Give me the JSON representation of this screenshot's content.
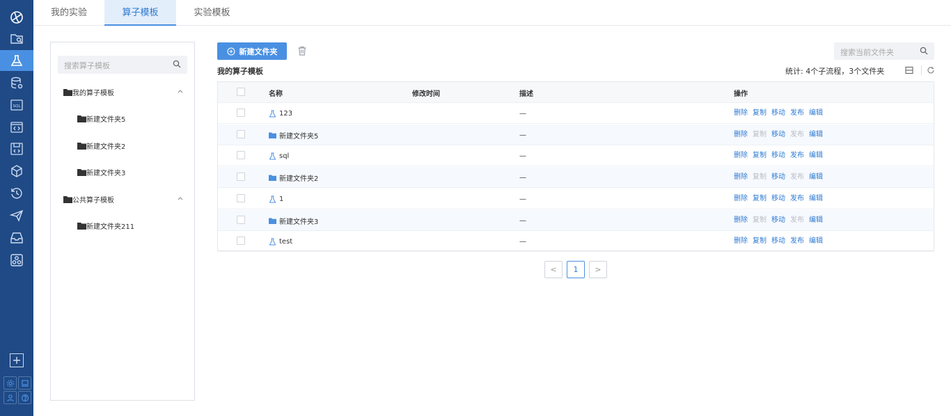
{
  "rail": {
    "items": [
      {
        "icon": "globe-icon"
      },
      {
        "icon": "folder-search-icon"
      },
      {
        "icon": "flask-icon",
        "active": true
      },
      {
        "icon": "database-icon"
      },
      {
        "icon": "sql-icon",
        "text": "SQL"
      },
      {
        "icon": "code-window-icon"
      },
      {
        "icon": "code-save-icon"
      },
      {
        "icon": "cube-icon"
      },
      {
        "icon": "history-icon"
      },
      {
        "icon": "send-icon"
      },
      {
        "icon": "inbox-icon"
      },
      {
        "icon": "cluster-icon"
      }
    ],
    "bottom": [
      "add-icon",
      "settings-icon",
      "monitor-icon",
      "user-icon",
      "help-icon"
    ]
  },
  "tabs": [
    {
      "label": "我的实验",
      "active": false
    },
    {
      "label": "算子模板",
      "active": true
    },
    {
      "label": "实验模板",
      "active": false
    }
  ],
  "left_panel": {
    "search_placeholder": "搜索算子模板",
    "tree": [
      {
        "label": "我的算子模板",
        "level": 0,
        "expanded": true
      },
      {
        "label": "新建文件夹5",
        "level": 1
      },
      {
        "label": "新建文件夹2",
        "level": 1
      },
      {
        "label": "新建文件夹3",
        "level": 1
      },
      {
        "label": "公共算子模板",
        "level": 0,
        "expanded": true
      },
      {
        "label": "新建文件夹211",
        "level": 1
      }
    ]
  },
  "toolbar": {
    "new_folder_label": "新建文件夹",
    "search_placeholder": "搜索当前文件夹"
  },
  "section": {
    "title": "我的算子模板",
    "stats": "统计: 4个子流程，3个文件夹"
  },
  "table": {
    "columns": [
      "名称",
      "修改时间",
      "描述",
      "操作"
    ],
    "actions": [
      "删除",
      "复制",
      "移动",
      "发布",
      "编辑"
    ],
    "rows": [
      {
        "type": "operator",
        "name": "123",
        "time": "",
        "desc": "—",
        "folder": false
      },
      {
        "type": "folder",
        "name": "新建文件夹5",
        "time": "",
        "desc": "—",
        "folder": true
      },
      {
        "type": "operator",
        "name": "sql",
        "time": "",
        "desc": "—",
        "folder": false
      },
      {
        "type": "folder",
        "name": "新建文件夹2",
        "time": "",
        "desc": "—",
        "folder": true
      },
      {
        "type": "operator",
        "name": "1",
        "time": "",
        "desc": "—",
        "folder": false
      },
      {
        "type": "folder",
        "name": "新建文件夹3",
        "time": "",
        "desc": "—",
        "folder": true
      },
      {
        "type": "operator",
        "name": "test",
        "time": "",
        "desc": "—",
        "folder": false
      }
    ]
  },
  "pagination": {
    "prev": "<",
    "current": "1",
    "next": ">"
  },
  "colors": {
    "rail": "#1f4a86",
    "accent": "#4a90e2",
    "link": "#2f7bd4",
    "disabled": "#b9bdc4"
  }
}
